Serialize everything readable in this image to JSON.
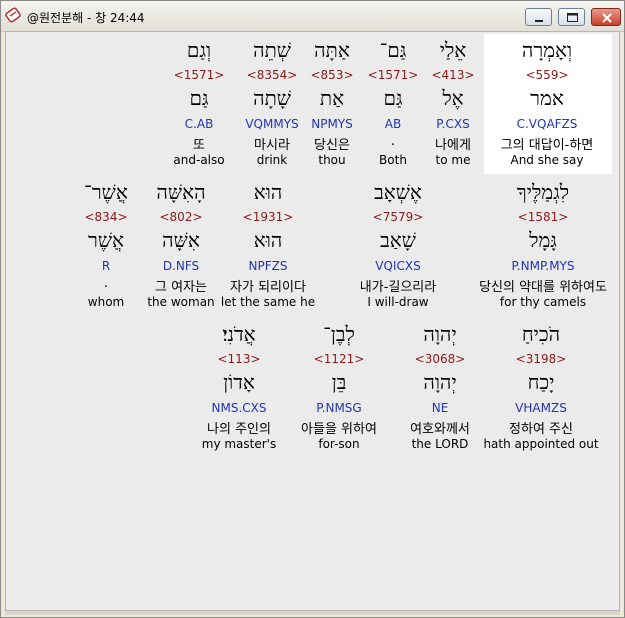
{
  "window": {
    "title": "@원전분해 - 창 24:44",
    "buttons": {
      "minimize": "minimize",
      "maximize": "maximize",
      "close": "close"
    },
    "icons": {
      "app": "scroll-icon"
    }
  },
  "lines": [
    {
      "words": [
        {
          "heb": "וְאָמְרָה",
          "num": "<559>",
          "root": "אמר",
          "parse": "C.VQAFZS",
          "kor": "그의 대답이-하면",
          "eng": "And she say",
          "highlighted": true
        },
        {
          "heb": "אֵלַי",
          "num": "<413>",
          "root": "אֶל",
          "parse": "P.CXS",
          "kor": "나에게",
          "eng": "to me"
        },
        {
          "heb": "גַּם־",
          "num": "<1571>",
          "root": "גַּם",
          "parse": "AB",
          "kor": ".",
          "eng": "Both"
        },
        {
          "heb": "אַתָּה",
          "num": "<853>",
          "root": "אַת",
          "parse": "NPMYS",
          "kor": "당신은",
          "eng": "thou"
        },
        {
          "heb": "שְׁתֵה",
          "num": "<8354>",
          "root": "שָׁתָה",
          "parse": "VQMMYS",
          "kor": "마시라",
          "eng": "drink"
        },
        {
          "heb": "וְגַם",
          "num": "<1571>",
          "root": "גַּם",
          "parse": "C.AB",
          "kor": "또",
          "eng": "and-also"
        }
      ]
    },
    {
      "words": [
        {
          "heb": "לִגְמַלֶּיךָ",
          "num": "<1581>",
          "root": "גָּמָל",
          "parse": "P.NMP.MYS",
          "kor": "당신의 약대를 위하여도",
          "eng": "for thy camels"
        },
        {
          "heb": "אֶשְׁאָב",
          "num": "<7579>",
          "root": "שָׁאַב",
          "parse": "VQICXS",
          "kor": "내가-길으리라",
          "eng": "I will-draw"
        },
        {
          "heb": "הוּא",
          "num": "<1931>",
          "root": "הוּא",
          "parse": "NPFZS",
          "kor": "자가 되리이다",
          "eng": "let the same he"
        },
        {
          "heb": "הָאִשָּׁה",
          "num": "<802>",
          "root": "אִשָּׁה",
          "parse": "D.NFS",
          "kor": "그 여자는",
          "eng": "the woman"
        },
        {
          "heb": "אֲשֶׁר־",
          "num": "<834>",
          "root": "אֲשֶׁר",
          "parse": "R",
          "kor": ".",
          "eng": "whom"
        }
      ]
    },
    {
      "words": [
        {
          "heb": "הֹכִיחַ",
          "num": "<3198>",
          "root": "יָכַח",
          "parse": "VHAMZS",
          "kor": "정하여 주신",
          "eng": "hath appointed out"
        },
        {
          "heb": "יְהוָה",
          "num": "<3068>",
          "root": "יְהוָה",
          "parse": "NE",
          "kor": "여호와께서",
          "eng": "the LORD"
        },
        {
          "heb": "לְבֶן־",
          "num": "<1121>",
          "root": "בֵּן",
          "parse": "P.NMSG",
          "kor": "아들을 위하여",
          "eng": "for-son"
        },
        {
          "heb": "אֲדֹנִי׃",
          "num": "<113>",
          "root": "אָדוֹן",
          "parse": "NMS.CXS",
          "kor": "나의 주인의",
          "eng": "my master's"
        }
      ]
    }
  ]
}
